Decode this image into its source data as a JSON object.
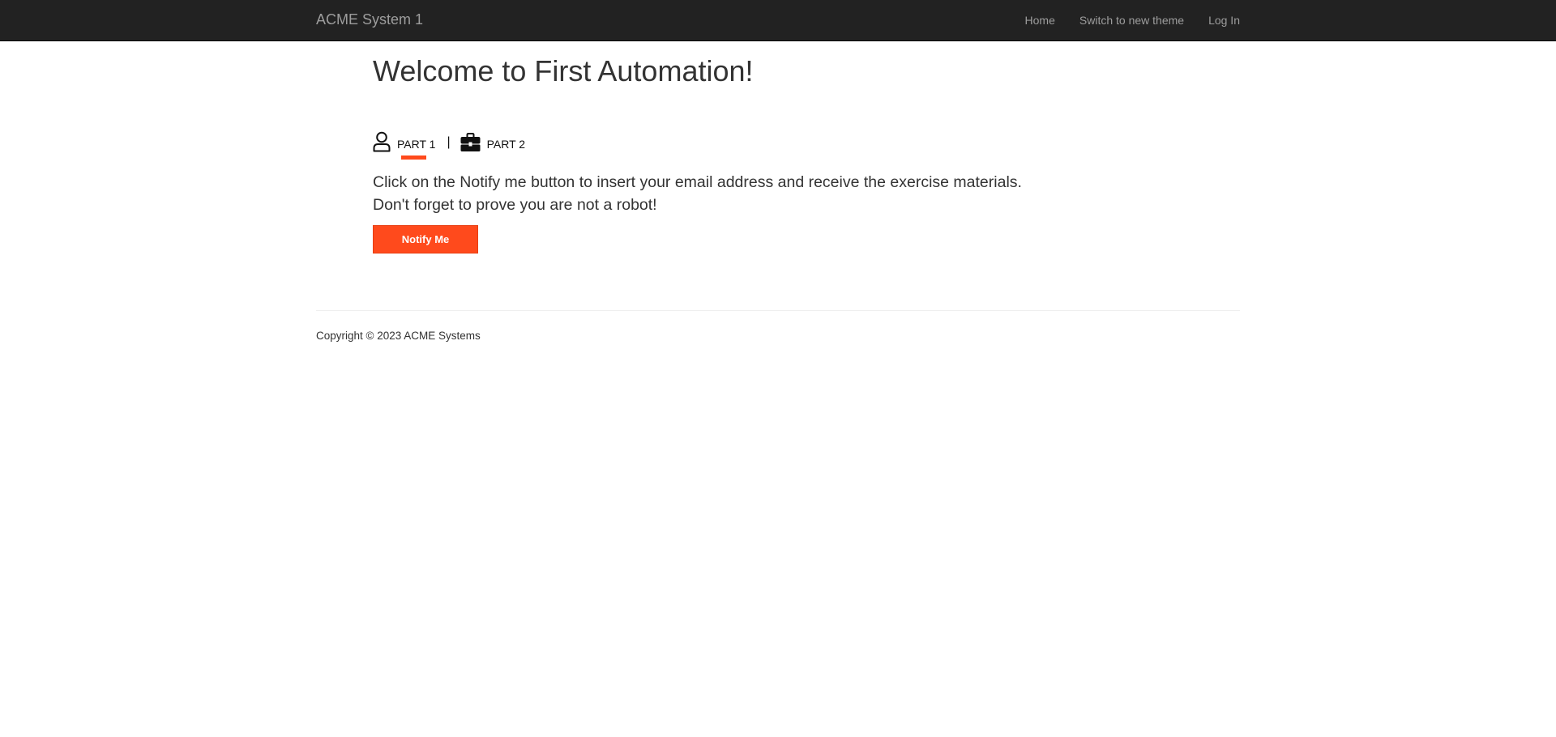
{
  "navbar": {
    "brand": "ACME System 1",
    "links": [
      "Home",
      "Switch to new theme",
      "Log In"
    ]
  },
  "main": {
    "title": "Welcome to First Automation!",
    "tabs": [
      {
        "label": "PART 1",
        "icon": "user-icon",
        "active": true
      },
      {
        "label": "PART 2",
        "icon": "briefcase-icon",
        "active": false
      }
    ],
    "tab_separator": "|",
    "message_lines": [
      "Click on the Notify me button to insert your email address and receive the exercise materials.",
      "Don't forget to prove you are not a robot!"
    ],
    "notify_button": "Notify Me"
  },
  "footer": {
    "copyright": "Copyright © 2023 ACME Systems"
  },
  "colors": {
    "navbar_bg": "#222222",
    "accent": "#ff4a1c",
    "nav_text": "#9d9d9d"
  }
}
